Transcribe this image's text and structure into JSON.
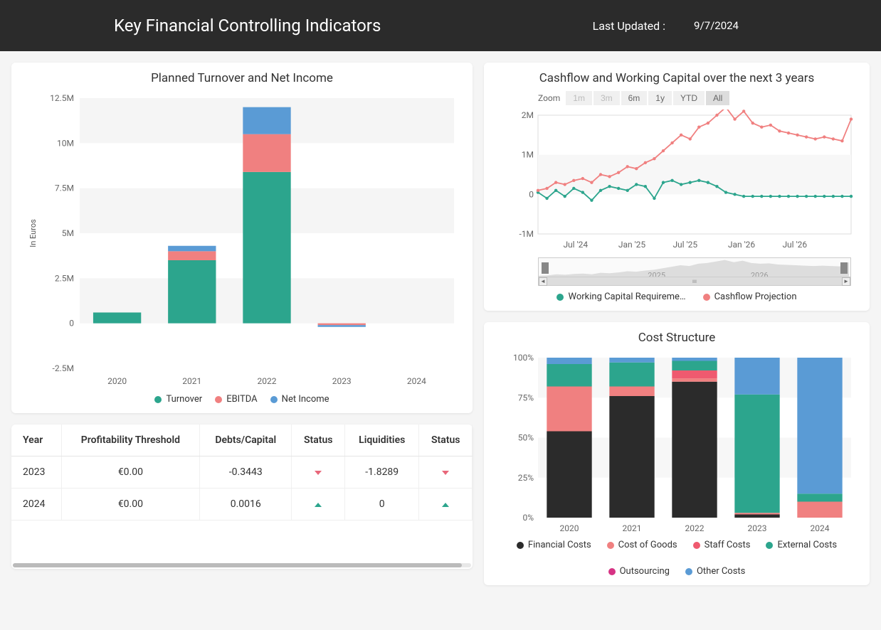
{
  "header": {
    "title": "Key Financial Controlling Indicators",
    "updated_label": "Last Updated :",
    "updated_date": "9/7/2024"
  },
  "turnover_chart": {
    "title": "Planned Turnover and Net Income",
    "y_title": "In Euros",
    "legend": {
      "turnover": "Turnover",
      "ebitda": "EBITDA",
      "net_income": "Net Income"
    }
  },
  "cashflow_chart": {
    "title": "Cashflow and Working Capital over the next 3 years",
    "zoom_label": "Zoom",
    "zoom_buttons": [
      "1m",
      "3m",
      "6m",
      "1y",
      "YTD",
      "All"
    ],
    "legend": {
      "wc": "Working Capital Requireme…",
      "cf": "Cashflow Projection"
    },
    "nav_years": {
      "y1": "2025",
      "y2": "2026"
    }
  },
  "cost_chart": {
    "title": "Cost Structure",
    "legend": {
      "financial": "Financial Costs",
      "cogs": "Cost of Goods",
      "staff": "Staff Costs",
      "external": "External Costs",
      "outsourcing": "Outsourcing",
      "other": "Other Costs"
    }
  },
  "table": {
    "headers": {
      "year": "Year",
      "pt": "Profitability Threshold",
      "dc": "Debts/Capital",
      "status1": "Status",
      "liq": "Liquidities",
      "status2": "Status"
    },
    "rows": [
      {
        "year": "2023",
        "pt": "€0.00",
        "dc": "-0.3443",
        "s1": "down",
        "liq": "-1.8289",
        "s2": "down"
      },
      {
        "year": "2024",
        "pt": "€0.00",
        "dc": "0.0016",
        "s1": "up",
        "liq": "0",
        "s2": "up"
      }
    ]
  },
  "chart_data": [
    {
      "type": "bar",
      "title": "Planned Turnover and Net Income",
      "ylabel": "In Euros",
      "categories": [
        "2020",
        "2021",
        "2022",
        "2023",
        "2024"
      ],
      "ylim": [
        -2500000,
        12500000
      ],
      "y_ticks": [
        "-2.5M",
        "0",
        "2.5M",
        "5M",
        "7.5M",
        "10M",
        "12.5M"
      ],
      "series": [
        {
          "name": "Turnover",
          "color": "#2ca58d",
          "values": [
            600000,
            3500000,
            8400000,
            0,
            0
          ]
        },
        {
          "name": "EBITDA",
          "color": "#f08080",
          "values": [
            0,
            500000,
            2100000,
            -100000,
            0
          ]
        },
        {
          "name": "Net Income",
          "color": "#5a9bd5",
          "values": [
            0,
            300000,
            1500000,
            -100000,
            0
          ]
        }
      ],
      "stacked": true
    },
    {
      "type": "line",
      "title": "Cashflow and Working Capital over the next 3 years",
      "x_ticks": [
        "Jul '24",
        "Jan '25",
        "Jul '25",
        "Jan '26",
        "Jul '26"
      ],
      "ylim": [
        -1000000,
        2000000
      ],
      "y_ticks": [
        "-1M",
        "0",
        "1M",
        "2M"
      ],
      "series": [
        {
          "name": "Working Capital Requirement",
          "color": "#2ca58d",
          "values": [
            50000,
            -100000,
            100000,
            -50000,
            150000,
            50000,
            -150000,
            100000,
            200000,
            150000,
            100000,
            250000,
            200000,
            -100000,
            300000,
            350000,
            250000,
            300000,
            350000,
            300000,
            200000,
            50000,
            0,
            -50000,
            -50000,
            -50000,
            -50000,
            -50000,
            -50000,
            -50000,
            -50000,
            -50000,
            -50000,
            -50000,
            -50000,
            -50000
          ]
        },
        {
          "name": "Cashflow Projection",
          "color": "#f08080",
          "values": [
            100000,
            150000,
            300000,
            250000,
            350000,
            400000,
            300000,
            500000,
            450000,
            550000,
            700000,
            650000,
            800000,
            900000,
            1100000,
            1300000,
            1500000,
            1400000,
            1700000,
            1800000,
            2000000,
            2200000,
            1900000,
            2100000,
            1800000,
            1700000,
            1750000,
            1600000,
            1550000,
            1500000,
            1450000,
            1400000,
            1450000,
            1400000,
            1350000,
            1900000
          ]
        }
      ]
    },
    {
      "type": "bar",
      "title": "Cost Structure",
      "stacked": true,
      "percentage": true,
      "categories": [
        "2020",
        "2021",
        "2022",
        "2023",
        "2024"
      ],
      "ylim": [
        0,
        100
      ],
      "y_ticks": [
        "0%",
        "25%",
        "50%",
        "75%",
        "100%"
      ],
      "series": [
        {
          "name": "Financial Costs",
          "color": "#2b2b2b",
          "values": [
            54,
            76,
            85,
            2,
            0
          ]
        },
        {
          "name": "Cost of Goods",
          "color": "#f08080",
          "values": [
            28,
            6,
            2,
            1,
            10
          ]
        },
        {
          "name": "Staff Costs",
          "color": "#ef5a6f",
          "values": [
            0,
            0,
            5,
            0,
            0
          ]
        },
        {
          "name": "External Costs",
          "color": "#2ca58d",
          "values": [
            14,
            15,
            6,
            74,
            5
          ]
        },
        {
          "name": "Outsourcing",
          "color": "#d63384",
          "values": [
            0,
            0,
            0,
            0,
            0
          ]
        },
        {
          "name": "Other Costs",
          "color": "#5a9bd5",
          "values": [
            4,
            3,
            2,
            23,
            85
          ]
        }
      ]
    }
  ]
}
